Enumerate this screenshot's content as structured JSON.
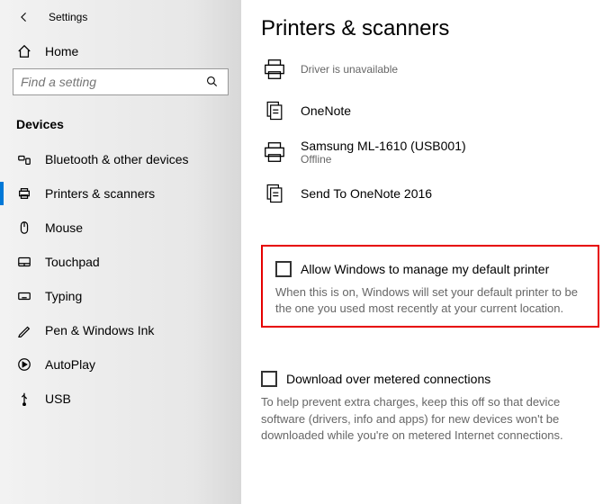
{
  "titlebar": {
    "title": "Settings"
  },
  "sidebar": {
    "home_label": "Home",
    "search_placeholder": "Find a setting",
    "category": "Devices",
    "items": [
      {
        "label": "Bluetooth & other devices"
      },
      {
        "label": "Printers & scanners"
      },
      {
        "label": "Mouse"
      },
      {
        "label": "Touchpad"
      },
      {
        "label": "Typing"
      },
      {
        "label": "Pen & Windows Ink"
      },
      {
        "label": "AutoPlay"
      },
      {
        "label": "USB"
      }
    ]
  },
  "main": {
    "title": "Printers & scanners",
    "printers": [
      {
        "name": "",
        "sub": "Driver is unavailable"
      },
      {
        "name": "OneNote",
        "sub": ""
      },
      {
        "name": "Samsung ML-1610 (USB001)",
        "sub": "Offline"
      },
      {
        "name": "Send To OneNote 2016",
        "sub": ""
      }
    ],
    "default_printer": {
      "label": "Allow Windows to manage my default printer",
      "help": "When this is on, Windows will set your default printer to be the one you used most recently at your current location."
    },
    "metered": {
      "label": "Download over metered connections",
      "help": "To help prevent extra charges, keep this off so that device software (drivers, info and apps) for new devices won't be downloaded while you're on metered Internet connections."
    }
  }
}
